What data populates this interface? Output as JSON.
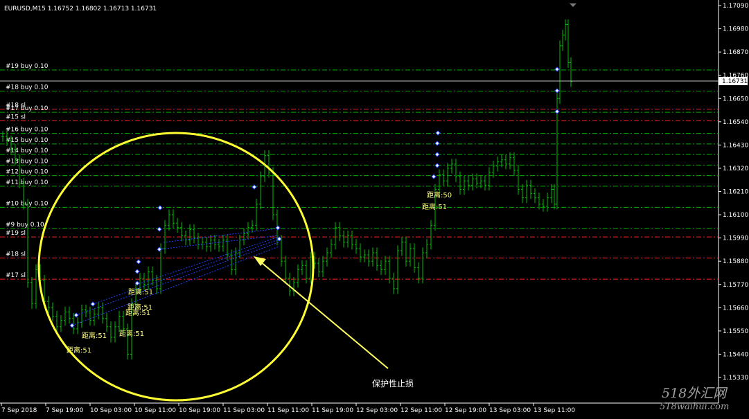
{
  "header": {
    "symbol_info": "EURUSD,M15  1.16752 1.16802 1.16713 1.16731"
  },
  "price_axis": {
    "ticks": [
      "1.17090",
      "1.16980",
      "1.16870",
      "1.16760",
      "1.16650",
      "1.16540",
      "1.16430",
      "1.16320",
      "1.16210",
      "1.16100",
      "1.15990",
      "1.15880",
      "1.15770",
      "1.15660",
      "1.15550",
      "1.15440",
      "1.15330"
    ],
    "current_price": "1.16731"
  },
  "time_axis": {
    "ticks": [
      "7 Sep 2018",
      "7 Sep 19:00",
      "10 Sep 03:00",
      "10 Sep 11:00",
      "10 Sep 19:00",
      "11 Sep 03:00",
      "11 Sep 11:00",
      "11 Sep 19:00",
      "12 Sep 03:00",
      "12 Sep 11:00",
      "12 Sep 19:00",
      "13 Sep 03:00",
      "13 Sep 11:00"
    ]
  },
  "order_lines": [
    {
      "label": "#19 buy 0.10",
      "price": 1.16785,
      "type": "buy",
      "color": "#00b000"
    },
    {
      "label": "#18 buy 0.10",
      "price": 1.16685,
      "type": "buy",
      "color": "#00b000"
    },
    {
      "label": "#18 sl",
      "price": 1.166,
      "type": "sl",
      "color": "#ff2020"
    },
    {
      "label": "#17 buy 0.10",
      "price": 1.16585,
      "type": "buy",
      "color": "#00b000"
    },
    {
      "label": "#15 sl",
      "price": 1.16545,
      "type": "sl",
      "color": "#ff2020"
    },
    {
      "label": "#16 buy 0.10",
      "price": 1.16485,
      "type": "buy",
      "color": "#00b000"
    },
    {
      "label": "#15 buy 0.10",
      "price": 1.16435,
      "type": "buy",
      "color": "#00b000"
    },
    {
      "label": "#14 buy 0.10",
      "price": 1.16385,
      "type": "buy",
      "color": "#00b000"
    },
    {
      "label": "#13 buy 0.10",
      "price": 1.16335,
      "type": "buy",
      "color": "#00b000"
    },
    {
      "label": "#12 buy 0.10",
      "price": 1.16285,
      "type": "buy",
      "color": "#00b000"
    },
    {
      "label": "#11 buy 0.10",
      "price": 1.16235,
      "type": "buy",
      "color": "#00b000"
    },
    {
      "label": "#10 buy 0.10",
      "price": 1.16135,
      "type": "buy",
      "color": "#00b000"
    },
    {
      "label": "#9 buy 0.10",
      "price": 1.16035,
      "type": "buy",
      "color": "#00b000"
    },
    {
      "label": "#19 sl",
      "price": 1.15995,
      "type": "sl",
      "color": "#ff2020"
    },
    {
      "label": "#18 sl",
      "price": 1.15895,
      "type": "sl",
      "color": "#ff2020"
    },
    {
      "label": "#17 sl",
      "price": 1.15795,
      "type": "sl",
      "color": "#ff2020"
    }
  ],
  "distance_labels": [
    "距离:51",
    "距离:51",
    "距离:51",
    "距离:51",
    "距离:51",
    "距离:51",
    "距离:50",
    "距离:51"
  ],
  "annotation": {
    "text": "保护性止损"
  },
  "watermark": "518外汇网\n518waihui.com",
  "colors": {
    "background": "#000000",
    "candle": "#00c000",
    "circle": "#ffff33",
    "axis_text": "#ffffff"
  }
}
